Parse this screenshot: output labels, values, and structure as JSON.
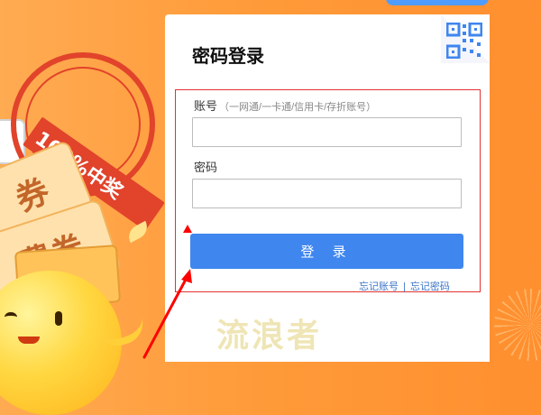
{
  "login": {
    "title": "密码登录",
    "account_label": "账号",
    "account_hint": "（一网通/一卡通/信用卡/存折账号）",
    "account_value": "",
    "password_label": "密码",
    "password_value": "",
    "login_button": "登 录",
    "forgot_account": "忘记账号",
    "separator": "|",
    "forgot_password": "忘记密码"
  },
  "promo": {
    "stamp_text": "100%中奖",
    "ticket_text_1": "券",
    "ticket_text_2": "费券"
  },
  "watermark_text": "流浪者",
  "colors": {
    "primary": "#3f86ef",
    "highlight": "#e23232",
    "link": "#3b74c8",
    "background": "#ff9b3a"
  },
  "icons": {
    "qr": "qr-code-icon",
    "arrow": "red-arrow-icon"
  }
}
